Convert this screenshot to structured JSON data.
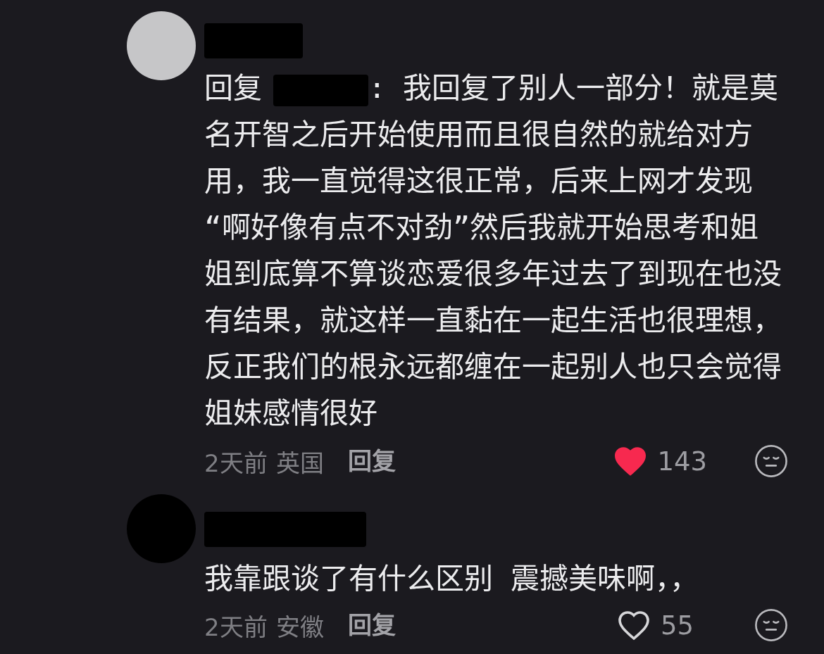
{
  "comments": [
    {
      "avatar": {
        "color": "#c6c6c8"
      },
      "reply_prefix": "回复",
      "text": ": 我回复了别人一部分！就是莫名开智之后开始使用而且很自然的就给对方用，我一直觉得这很正常，后来上网才发现“啊好像有点不对劲”然后我就开始思考和姐姐到底算不算谈恋爱很多年过去了到现在也没有结果，就这样一直黏在一起生活也很理想，反正我们的根永远都缠在一起别人也只会觉得姐妹感情很好",
      "time": "2天前",
      "location": "英国",
      "reply_button": "回复",
      "liked": true,
      "like_count": "143"
    },
    {
      "avatar": {
        "color": "#000000"
      },
      "text": "我靠跟谈了有什么区别 震撼美味啊，，",
      "time": "2天前",
      "location": "安徽",
      "reply_button": "回复",
      "liked": false,
      "like_count": "55"
    }
  ]
}
